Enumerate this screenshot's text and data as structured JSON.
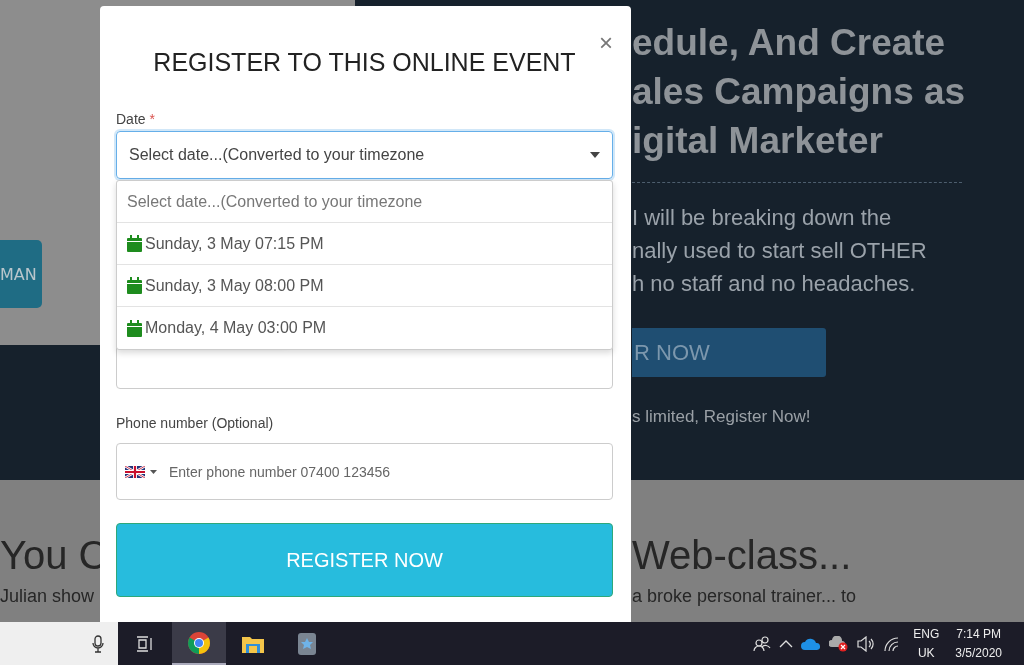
{
  "background_page": {
    "image_button": "MAN",
    "headline_lines": [
      "edule, And Create",
      "ales Campaigns as",
      "igital Marketer"
    ],
    "paragraph_lines": [
      "I will be breaking down the",
      "nally used to start sell OTHER",
      "h no staff and no headaches."
    ],
    "cta_button": "R NOW",
    "cta_note": "s limited, Register Now!",
    "section_title_left": "You C",
    "section_title_right": "Web-class...",
    "section_text_left": "Julian show",
    "section_text_right": "a broke personal trainer... to"
  },
  "modal": {
    "close": "×",
    "title": "REGISTER TO THIS ONLINE EVENT",
    "date_label": "Date",
    "required_mark": "*",
    "date_select": {
      "value": "Select date...(Converted to your timezone",
      "expanded": true
    },
    "date_options": [
      {
        "kind": "placeholder",
        "label": "Select date...(Converted to your timezone"
      },
      {
        "kind": "date",
        "label": "Sunday, 3 May 07:15 PM"
      },
      {
        "kind": "date",
        "label": "Sunday, 3 May 08:00 PM"
      },
      {
        "kind": "date",
        "label": "Monday, 4 May 03:00 PM"
      }
    ],
    "phone_label": "Phone number (Optional)",
    "phone_placeholder": "Enter phone number 07400 123456",
    "submit": "REGISTER NOW"
  },
  "taskbar": {
    "apps": [
      {
        "kind": "browser",
        "selected": true
      },
      {
        "kind": "folder",
        "selected": false
      },
      {
        "kind": "app",
        "selected": false
      }
    ],
    "language": "ENG",
    "region": "UK",
    "time": "7:14 PM",
    "date": "3/5/2020"
  }
}
